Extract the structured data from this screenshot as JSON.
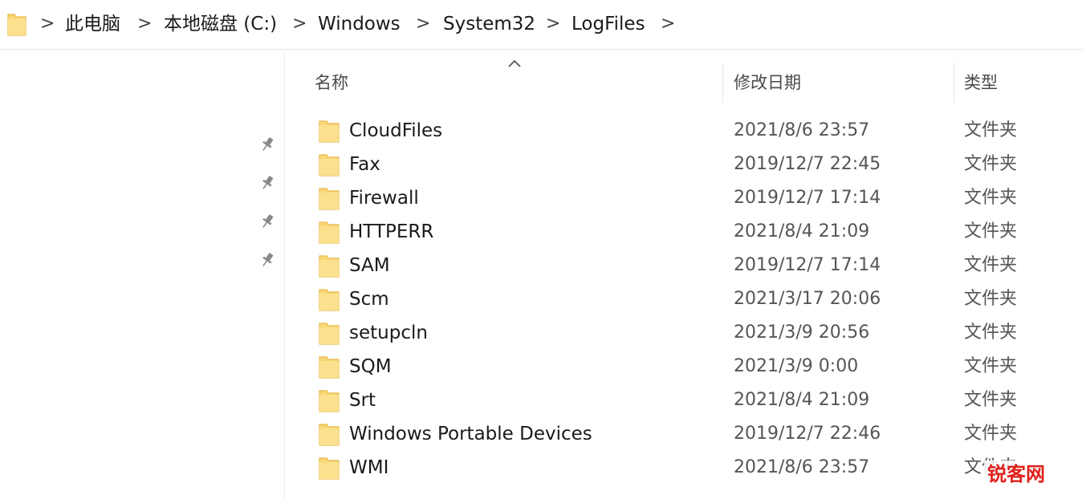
{
  "address": {
    "folder_icon": "folder-icon",
    "crumbs": [
      "此电脑",
      "本地磁盘 (C:)",
      "Windows",
      "System32",
      "LogFiles"
    ],
    "separator": ">"
  },
  "nav": {
    "pins": [
      "pin-icon",
      "pin-icon",
      "pin-icon",
      "pin-icon"
    ]
  },
  "columns": {
    "name": "名称",
    "date": "修改日期",
    "type": "类型",
    "sort_icon": "sort-ascending-caret-icon"
  },
  "files": [
    {
      "name": "CloudFiles",
      "date": "2021/8/6 23:57",
      "type": "文件夹"
    },
    {
      "name": "Fax",
      "date": "2019/12/7 22:45",
      "type": "文件夹"
    },
    {
      "name": "Firewall",
      "date": "2019/12/7 17:14",
      "type": "文件夹"
    },
    {
      "name": "HTTPERR",
      "date": "2021/8/4 21:09",
      "type": "文件夹"
    },
    {
      "name": "SAM",
      "date": "2019/12/7 17:14",
      "type": "文件夹"
    },
    {
      "name": "Scm",
      "date": "2021/3/17 20:06",
      "type": "文件夹"
    },
    {
      "name": "setupcln",
      "date": "2021/3/9 20:56",
      "type": "文件夹"
    },
    {
      "name": "SQM",
      "date": "2021/3/9 0:00",
      "type": "文件夹"
    },
    {
      "name": "Srt",
      "date": "2021/8/4 21:09",
      "type": "文件夹"
    },
    {
      "name": "Windows Portable Devices",
      "date": "2019/12/7 22:46",
      "type": "文件夹"
    },
    {
      "name": "WMI",
      "date": "2021/8/6 23:57",
      "type": "文件夹"
    }
  ],
  "watermark": "锐客网",
  "colors": {
    "folder": "#f8d775",
    "folder_dark": "#e8b94a",
    "watermark": "#e0201b"
  }
}
